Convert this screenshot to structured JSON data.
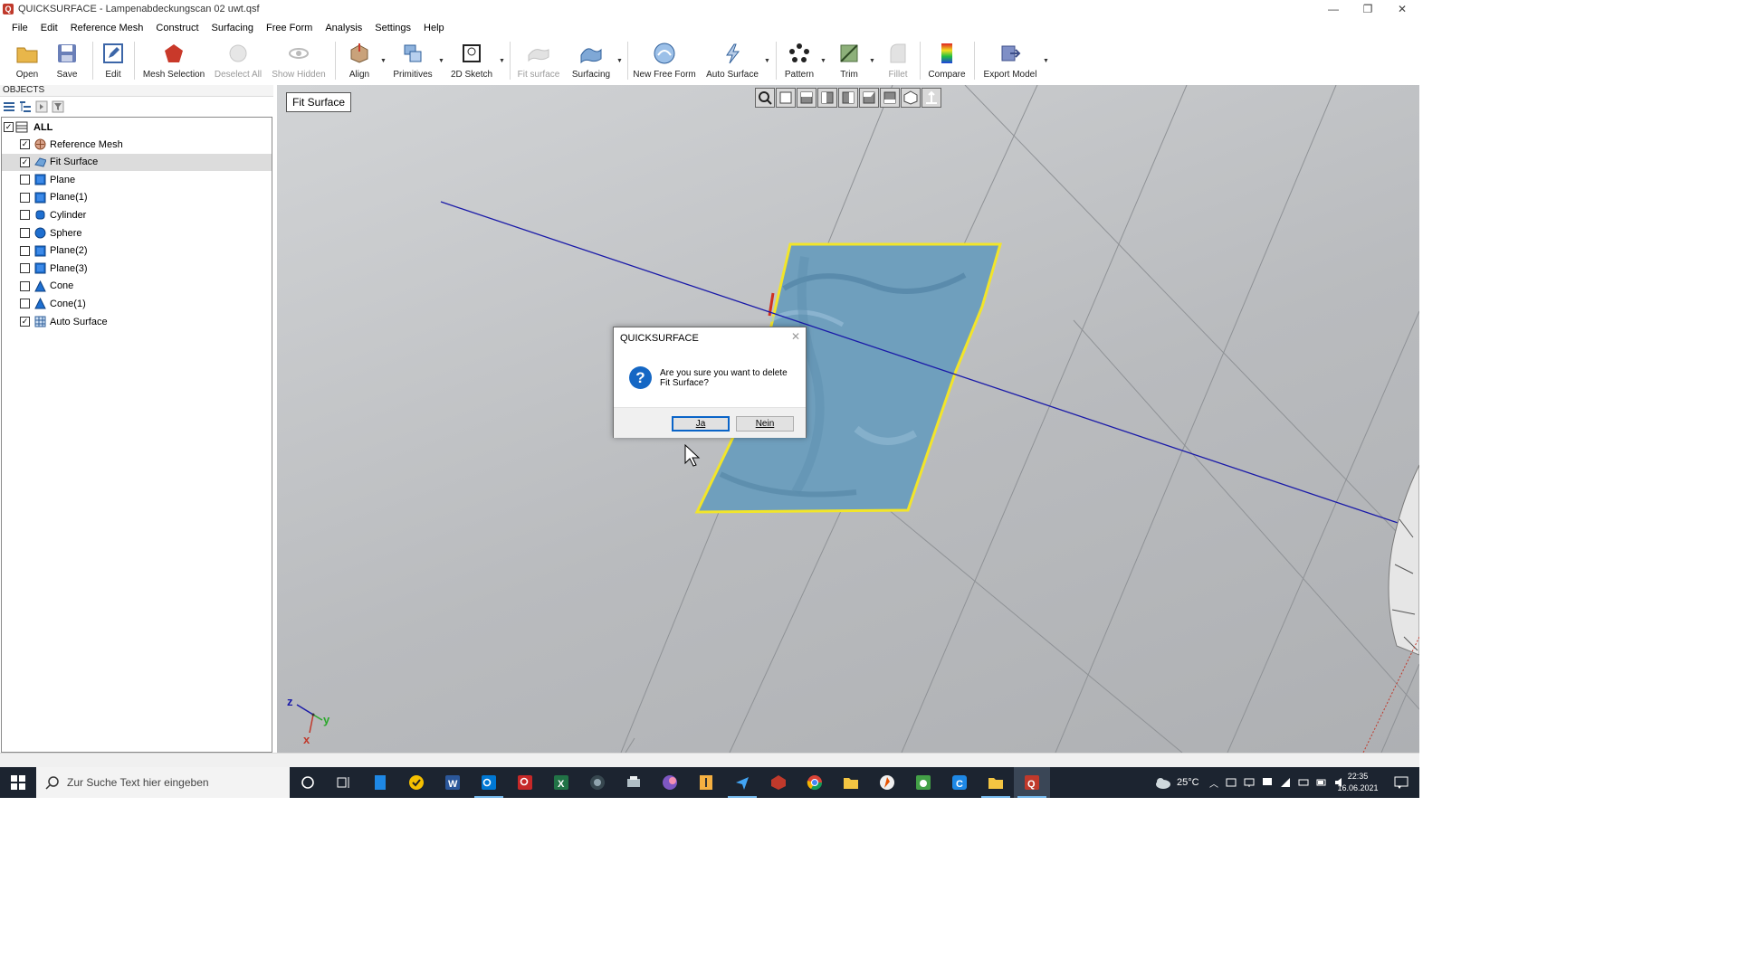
{
  "window": {
    "title": "QUICKSURFACE - Lampenabdeckungscan 02 uwt.qsf",
    "minimize": "—",
    "restore": "❐",
    "close": "✕"
  },
  "menu": [
    "File",
    "Edit",
    "Reference Mesh",
    "Construct",
    "Surfacing",
    "Free Form",
    "Analysis",
    "Settings",
    "Help"
  ],
  "toolbar": {
    "open": "Open",
    "save": "Save",
    "edit": "Edit",
    "mesh_selection": "Mesh Selection",
    "deselect_all": "Deselect All",
    "show_hidden": "Show Hidden",
    "align": "Align",
    "primitives": "Primitives",
    "sketch_2d": "2D Sketch",
    "fit_surface": "Fit surface",
    "surfacing": "Surfacing",
    "new_free_form": "New Free Form",
    "auto_surface": "Auto Surface",
    "pattern": "Pattern",
    "trim": "Trim",
    "fillet": "Fillet",
    "compare": "Compare",
    "export_model": "Export Model"
  },
  "objects_panel": {
    "header": "OBJECTS",
    "all_label": "ALL",
    "items": [
      {
        "label": "Reference Mesh",
        "checked": true,
        "icon": "mesh-icon"
      },
      {
        "label": "Fit Surface",
        "checked": true,
        "icon": "fit-surface-icon",
        "selected": true
      },
      {
        "label": "Plane",
        "checked": false,
        "icon": "plane-icon"
      },
      {
        "label": "Plane(1)",
        "checked": false,
        "icon": "plane-icon"
      },
      {
        "label": "Cylinder",
        "checked": false,
        "icon": "cylinder-icon"
      },
      {
        "label": "Sphere",
        "checked": false,
        "icon": "sphere-icon"
      },
      {
        "label": "Plane(2)",
        "checked": false,
        "icon": "plane-icon"
      },
      {
        "label": "Plane(3)",
        "checked": false,
        "icon": "plane-icon"
      },
      {
        "label": "Cone",
        "checked": false,
        "icon": "cone-icon"
      },
      {
        "label": "Cone(1)",
        "checked": false,
        "icon": "cone-icon"
      },
      {
        "label": "Auto Surface",
        "checked": true,
        "icon": "auto-surface-icon"
      }
    ]
  },
  "viewport": {
    "active_object_label": "Fit Surface",
    "axes": {
      "z": "z",
      "y": "y",
      "x": "x"
    }
  },
  "dialog": {
    "title": "QUICKSURFACE",
    "icon_glyph": "?",
    "message": "Are you sure you want to delete Fit Surface?",
    "yes": "Ja",
    "no": "Nein",
    "close": "✕"
  },
  "taskbar": {
    "search_placeholder": "Zur Suche Text hier eingeben",
    "temperature": "25°C",
    "time": "22:35",
    "date": "16.06.2021"
  },
  "colors": {
    "surface_fill": "#6f9fbd",
    "surface_outline": "#f2e52a",
    "axis_line": "#1a1aa8",
    "dialog_accent": "#0a64c8"
  }
}
